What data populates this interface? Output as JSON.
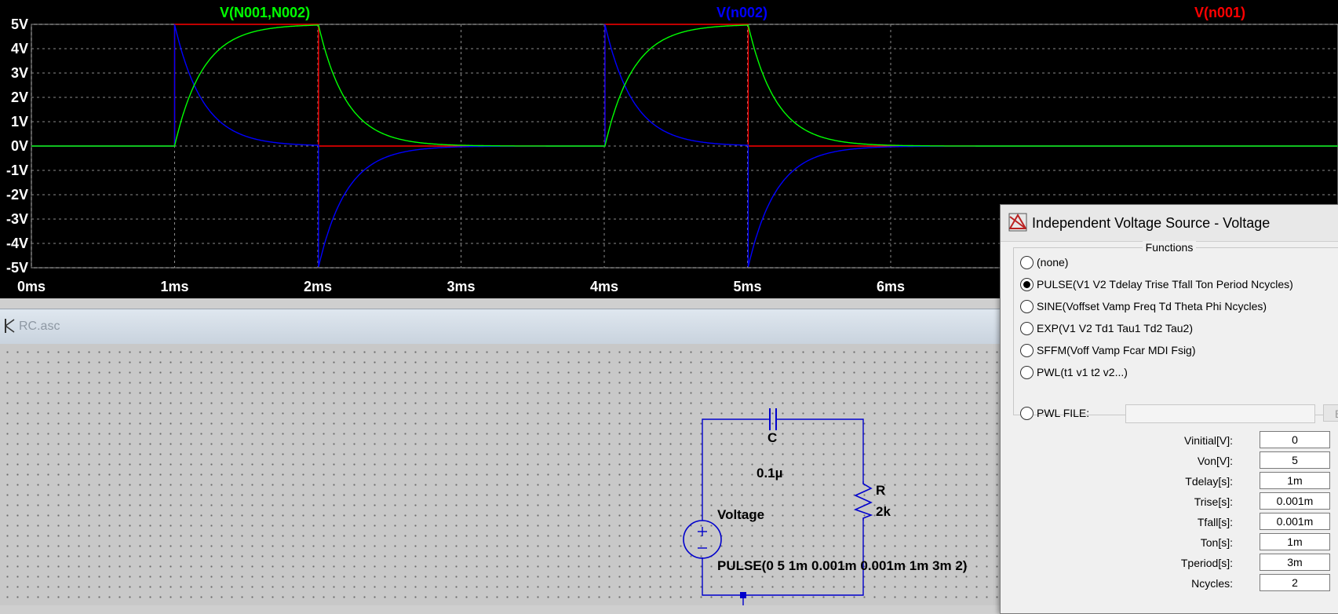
{
  "plot": {
    "traces": [
      {
        "name": "V(N001,N002)",
        "color": "#00ff00"
      },
      {
        "name": "V(n002)",
        "color": "#0000ff"
      },
      {
        "name": "V(n001)",
        "color": "#ff0000"
      }
    ],
    "y_ticks": [
      "5V",
      "4V",
      "3V",
      "2V",
      "1V",
      "0V",
      "-1V",
      "-2V",
      "-3V",
      "-4V",
      "-5V"
    ],
    "x_ticks": [
      "0ms",
      "1ms",
      "2ms",
      "3ms",
      "4ms",
      "5ms",
      "6ms"
    ]
  },
  "schematic": {
    "file_title": "RC.asc",
    "capacitor": {
      "name": "C",
      "value": "0.1µ"
    },
    "resistor": {
      "name": "R",
      "value": "2k"
    },
    "source": {
      "name": "Voltage",
      "value": "PULSE(0 5 1m 0.001m 0.001m 1m 3m 2)"
    }
  },
  "dialog": {
    "title": "Independent Voltage Source - Voltage",
    "functions_label": "Functions",
    "options": [
      {
        "label": "(none)",
        "selected": false
      },
      {
        "label": "PULSE(V1 V2 Tdelay Trise Tfall Ton Period Ncycles)",
        "selected": true
      },
      {
        "label": "SINE(Voffset Vamp Freq Td Theta Phi Ncycles)",
        "selected": false
      },
      {
        "label": "EXP(V1 V2 Td1 Tau1 Td2 Tau2)",
        "selected": false
      },
      {
        "label": "SFFM(Voff Vamp Fcar MDI Fsig)",
        "selected": false
      },
      {
        "label": "PWL(t1 v1 t2 v2...)",
        "selected": false
      },
      {
        "label": "PWL FILE:",
        "selected": false
      }
    ],
    "browse_label": "Br",
    "params": [
      {
        "label": "Vinitial[V]:",
        "value": "0"
      },
      {
        "label": "Von[V]:",
        "value": "5"
      },
      {
        "label": "Tdelay[s]:",
        "value": "1m"
      },
      {
        "label": "Trise[s]:",
        "value": "0.001m"
      },
      {
        "label": "Tfall[s]:",
        "value": "0.001m"
      },
      {
        "label": "Ton[s]:",
        "value": "1m"
      },
      {
        "label": "Tperiod[s]:",
        "value": "3m"
      },
      {
        "label": "Ncycles:",
        "value": "2"
      }
    ]
  }
}
